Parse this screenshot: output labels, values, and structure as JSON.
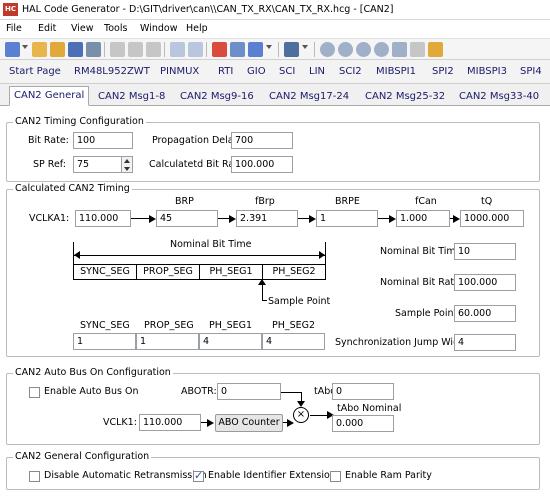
{
  "window": {
    "title": "HAL Code Generator - D:\\GIT\\driver\\can\\\\CAN_TX_RX\\CAN_TX_RX.hcg - [CAN2]",
    "icon_label": "HC"
  },
  "menu": [
    "File",
    "Edit",
    "View",
    "Tools",
    "Window",
    "Help"
  ],
  "toolbar_icons": [
    "new-icon",
    "open-icon",
    "save-icon",
    "print-icon",
    "cut-icon",
    "copy-icon",
    "paste-icon",
    "undo-icon",
    "redo-icon",
    "generate-icon",
    "settings-icon",
    "window-icon",
    "stack-icon",
    "back-icon",
    "forward-icon",
    "stop-icon",
    "refresh-icon",
    "home-icon",
    "document-icon",
    "folder-icon"
  ],
  "nav": [
    "Start Page",
    "RM48L952ZWT",
    "PINMUX",
    "RTI",
    "GIO",
    "SCI",
    "LIN",
    "SCI2",
    "MIBSPI1",
    "SPI2",
    "MIBSPI3",
    "SPI4"
  ],
  "tabs": [
    "CAN2 General",
    "CAN2 Msg1-8",
    "CAN2 Msg9-16",
    "CAN2 Msg17-24",
    "CAN2 Msg25-32",
    "CAN2 Msg33-40"
  ],
  "timing_config": {
    "title": "CAN2 Timing Configuration",
    "bit_rate_label": "Bit Rate:",
    "bit_rate": "100",
    "sp_ref_label": "SP Ref:",
    "sp_ref": "75",
    "prop_delay_label": "Propagation Delay:",
    "prop_delay": "700",
    "calc_bit_rate_label": "Calculatetd Bit Rate:",
    "calc_bit_rate": "100.000"
  },
  "calculated_timing": {
    "title": "Calculated CAN2 Timing",
    "vclka1_label": "VCLKA1:",
    "vclka1": "110.000",
    "brp_label": "BRP",
    "brp": "45",
    "fbrp_label": "fBrp",
    "fbrp": "2.391",
    "brpe_label": "BRPE",
    "brpe": "1",
    "fcan_label": "fCan",
    "fcan": "1.000",
    "tq_label": "tQ",
    "tq": "1000.000",
    "nominal_bit_time_caption": "Nominal Bit Time",
    "segments": [
      "SYNC_SEG",
      "PROP_SEG",
      "PH_SEG1",
      "PH_SEG2"
    ],
    "sample_point_caption": "Sample Point",
    "seg_values": [
      "1",
      "1",
      "4",
      "4"
    ],
    "nominal_bit_time_label": "Nominal Bit Time:",
    "nominal_bit_time": "10",
    "nominal_bit_rate_label": "Nominal Bit Rate:",
    "nominal_bit_rate": "100.000",
    "sample_point_label": "Sample Point:",
    "sample_point": "60.000",
    "sjw_label": "Synchronization Jump Width:",
    "sjw": "4"
  },
  "auto_bus": {
    "title": "CAN2 Auto Bus On Configuration",
    "enable_label": "Enable Auto Bus On",
    "enable_checked": false,
    "abotr_label": "ABOTR:",
    "abotr": "0",
    "tabo_label": "tAbo:",
    "tabo": "0",
    "vclk1_label": "VCLK1:",
    "vclk1": "110.000",
    "abo_counter_label": "ABO Counter",
    "tabo_nominal_label": "tAbo Nominal",
    "tabo_nominal": "0.000",
    "multiply_symbol": "×",
    "equals_symbol": "="
  },
  "general_config": {
    "title": "CAN2 General Configuration",
    "options": [
      {
        "label": "Disable Automatic Retransmission",
        "checked": false
      },
      {
        "label": "Enable Identifier Extension",
        "checked": true
      },
      {
        "label": "Enable Ram Parity",
        "checked": false
      }
    ]
  }
}
